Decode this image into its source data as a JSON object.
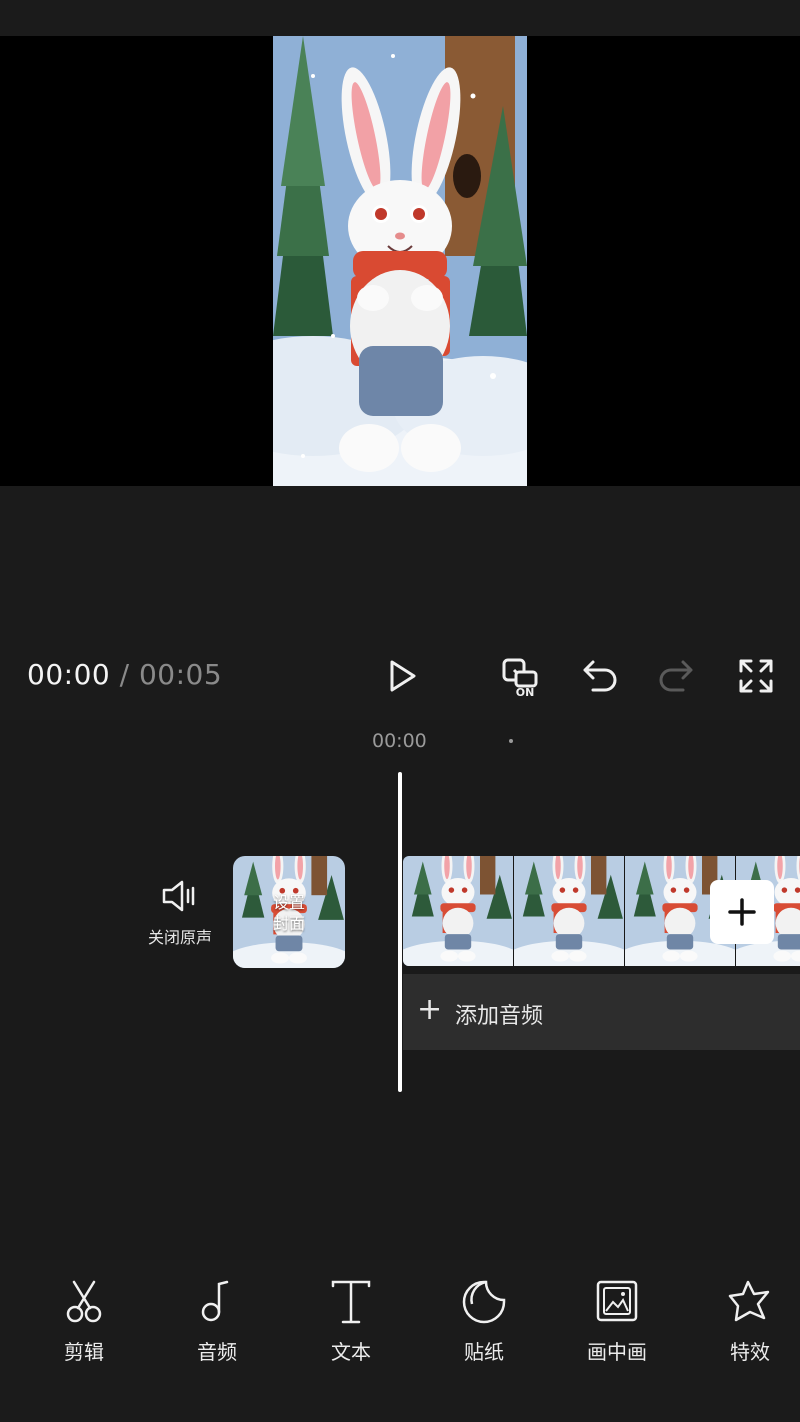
{
  "player": {
    "current_time": "00:00",
    "separator": "/",
    "duration": "00:05"
  },
  "timeline": {
    "ruler_time": "00:00",
    "mute_label": "关闭原声",
    "cover_label_line1": "设置",
    "cover_label_line2": "封面",
    "add_audio_label": "添加音频"
  },
  "toolbar": [
    {
      "label": "剪辑",
      "icon": "scissors-icon"
    },
    {
      "label": "音频",
      "icon": "music-note-icon"
    },
    {
      "label": "文本",
      "icon": "text-icon"
    },
    {
      "label": "贴纸",
      "icon": "sticker-icon"
    },
    {
      "label": "画中画",
      "icon": "picture-in-picture-icon"
    },
    {
      "label": "特效",
      "icon": "effects-star-icon"
    }
  ],
  "colors": {
    "background": "#1a1a1a",
    "preview_bg": "#000000",
    "audio_track": "#2d2d2d",
    "text": "#ffffff",
    "muted_text": "#8a8a8a"
  }
}
